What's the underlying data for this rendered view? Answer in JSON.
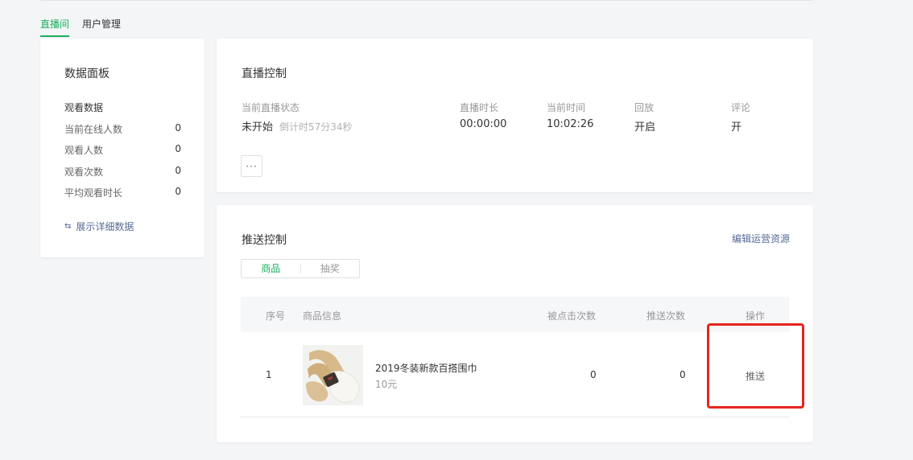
{
  "tabs": [
    {
      "label": "直播间",
      "active": true
    },
    {
      "label": "用户管理",
      "active": false
    }
  ],
  "dashboard": {
    "title": "数据面板",
    "subtitle": "观看数据",
    "stats": [
      {
        "label": "当前在线人数",
        "value": "0"
      },
      {
        "label": "观看人数",
        "value": "0"
      },
      {
        "label": "观看次数",
        "value": "0"
      },
      {
        "label": "平均观看时长",
        "value": "0"
      }
    ],
    "detail_link": "展示详细数据"
  },
  "live": {
    "title": "直播控制",
    "status_label": "当前直播状态",
    "status_value": "未开始",
    "countdown": "倒计时57分34秒",
    "duration_label": "直播时长",
    "duration_value": "00:00:00",
    "time_label": "当前时间",
    "time_value": "10:02:26",
    "replay_label": "回放",
    "replay_value": "开启",
    "comment_label": "评论",
    "comment_value": "开",
    "more_label": "···"
  },
  "push": {
    "title": "推送控制",
    "edit_link": "编辑运营资源",
    "segments": [
      {
        "label": "商品",
        "active": true
      },
      {
        "label": "抽奖",
        "active": false
      }
    ],
    "headers": {
      "index": "序号",
      "info": "商品信息",
      "clicks": "被点击次数",
      "pushes": "推送次数",
      "action": "操作"
    },
    "rows": [
      {
        "index": "1",
        "name": "2019冬装新款百搭围巾",
        "price": "10元",
        "clicks": "0",
        "pushes": "0",
        "action": "推送"
      }
    ]
  },
  "colors": {
    "accent": "#1aaf5d",
    "link": "#576b95",
    "highlight": "#e5251c"
  }
}
